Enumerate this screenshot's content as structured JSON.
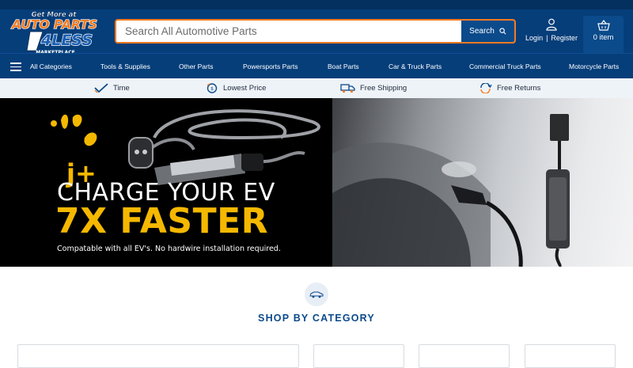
{
  "header": {
    "logo": {
      "line1": "Get More at",
      "line2": "AUTO PARTS",
      "line3": "4LESS",
      "line4": "MARKETPLACE"
    },
    "search": {
      "placeholder": "Search All Automotive Parts",
      "button_label": "Search"
    },
    "account": {
      "login": "Login",
      "separator": "|",
      "register": "Register"
    },
    "cart": {
      "label": "0 item"
    }
  },
  "nav": {
    "all_categories": "All Categories",
    "items": [
      "Tools & Supplies",
      "Other Parts",
      "Powersports Parts",
      "Boat Parts",
      "Car & Truck Parts",
      "Commercial Truck Parts",
      "Motorcycle Parts"
    ]
  },
  "trust": [
    {
      "label": "Time",
      "icon": "check-icon"
    },
    {
      "label": "Lowest Price",
      "icon": "price-tag-icon"
    },
    {
      "label": "Free Shipping",
      "icon": "truck-icon"
    },
    {
      "label": "Free Returns",
      "icon": "returns-icon"
    }
  ],
  "hero": {
    "brand": "j+",
    "title": "CHARGE YOUR EV",
    "subtitle": "7X FASTER",
    "note": "Compatable with all EV's. No hardwire installation required.",
    "accent_color": "#f5b800"
  },
  "categories": {
    "title": "SHOP BY CATEGORY"
  },
  "colors": {
    "primary": "#063e7a",
    "accent": "#f47b20",
    "button": "#0b4a8b"
  }
}
